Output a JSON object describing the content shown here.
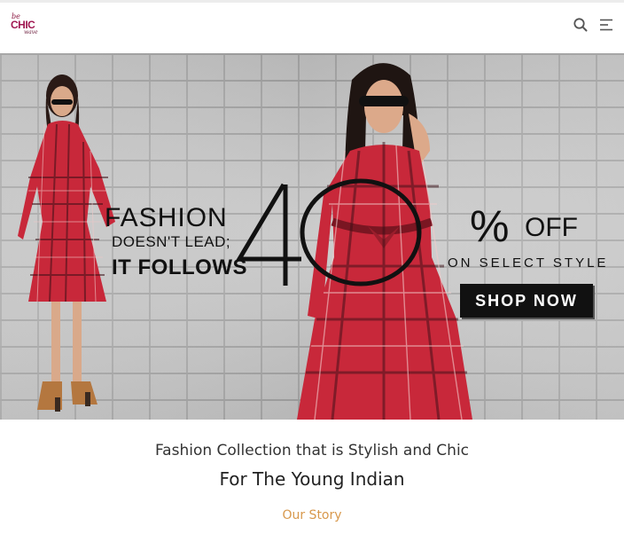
{
  "header": {
    "logo": {
      "script": "be",
      "main": "CHIC",
      "sub": "wave"
    },
    "icons": [
      "search-icon",
      "menu-icon"
    ]
  },
  "hero": {
    "line1": "FASHION",
    "line2": "DOESN'T LEAD;",
    "line3": "IT FOLLOWS",
    "number": "40",
    "percent": "%",
    "off": "OFF",
    "select": "ON SELECT STYLE",
    "cta": "SHOP NOW"
  },
  "content": {
    "tagline": "Fashion Collection that is Stylish and Chic",
    "subtitle": "For The Young Indian",
    "link": "Our Story"
  },
  "colors": {
    "logo": "#a01852",
    "link": "#d8984c",
    "dress": "#c8283a"
  }
}
